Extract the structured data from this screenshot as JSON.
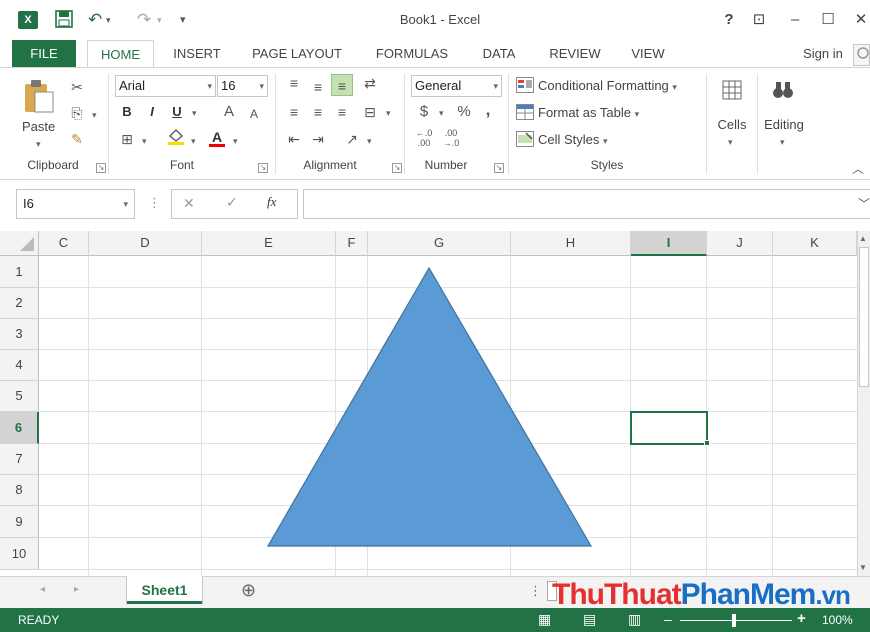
{
  "app": {
    "title": "Book1 - Excel",
    "logo_text": "X",
    "brand_color": "#217346"
  },
  "window_controls": {
    "help": "?",
    "ribbon_display": "⊡",
    "minimize": "–",
    "maximize": "☐",
    "close": "✕"
  },
  "qat": {
    "save": "💾",
    "undo": "↶",
    "redo": "↷",
    "customize": "▾"
  },
  "tabs": [
    "FILE",
    "HOME",
    "INSERT",
    "PAGE LAYOUT",
    "FORMULAS",
    "DATA",
    "REVIEW",
    "VIEW"
  ],
  "sign_in": "Sign in",
  "ribbon": {
    "clipboard": {
      "label": "Clipboard",
      "paste": "Paste"
    },
    "font": {
      "label": "Font",
      "name": "Arial",
      "size": "16",
      "bold": "B",
      "italic": "I",
      "underline": "U",
      "grow": "A",
      "shrink": "A",
      "font_color": "A"
    },
    "alignment": {
      "label": "Alignment"
    },
    "number": {
      "label": "Number",
      "format": "General",
      "currency": "$",
      "percent": "%",
      "comma": ","
    },
    "styles": {
      "label": "Styles",
      "conditional": "Conditional Formatting",
      "format_table": "Format as Table",
      "cell_styles": "Cell Styles"
    },
    "cells": {
      "label": "Cells"
    },
    "editing": {
      "label": "Editing"
    }
  },
  "formula_bar": {
    "name_box": "I6",
    "cancel": "✕",
    "enter": "✓",
    "fx": "fx",
    "value": ""
  },
  "grid": {
    "columns": [
      "C",
      "D",
      "E",
      "F",
      "G",
      "H",
      "I",
      "J",
      "K"
    ],
    "rows": [
      "1",
      "2",
      "3",
      "4",
      "5",
      "6",
      "7",
      "8",
      "9",
      "10"
    ],
    "active_cell": "I6",
    "shape": {
      "type": "isosceles triangle",
      "fill": "#5b9bd5",
      "stroke": "#41719c"
    }
  },
  "sheets": [
    "Sheet1"
  ],
  "add_sheet": "⊕",
  "status": {
    "text": "READY",
    "zoom": "100%",
    "zoom_out": "–",
    "zoom_in": "+"
  },
  "watermark": {
    "part1": "ThuThuat",
    "part2": "PhanMem",
    "part3": ".vn",
    "color1": "#e53030",
    "color2": "#1a6fc4"
  }
}
